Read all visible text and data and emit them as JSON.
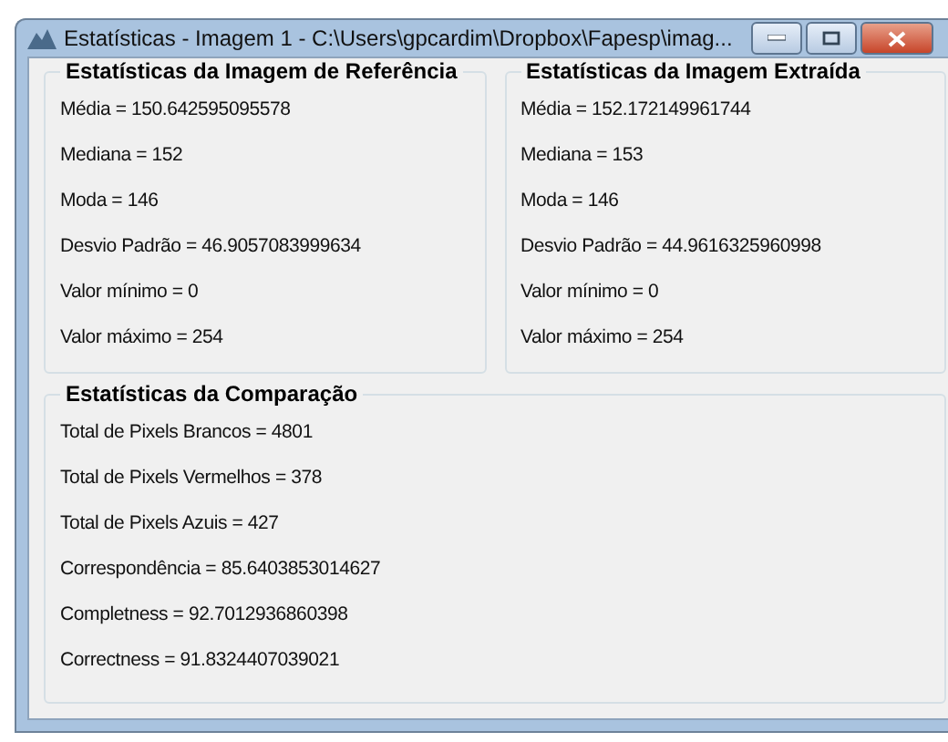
{
  "window": {
    "title": "Estatísticas - Imagem 1 - C:\\Users\\gpcardim\\Dropbox\\Fapesp\\imag..."
  },
  "groups": [
    {
      "title": "Estatísticas da Imagem de Referência",
      "lines": [
        "Média = 150.642595095578",
        "Mediana = 152",
        "Moda = 146",
        "Desvio Padrão = 46.9057083999634",
        "Valor mínimo = 0",
        "Valor máximo = 254"
      ]
    },
    {
      "title": "Estatísticas da Imagem Extraída",
      "lines": [
        "Média = 152.172149961744",
        "Mediana = 153",
        "Moda = 146",
        "Desvio Padrão = 44.9616325960998",
        "Valor mínimo = 0",
        "Valor máximo = 254"
      ]
    },
    {
      "title": "Estatísticas da Comparação",
      "lines": [
        "Total de Pixels Brancos = 4801",
        "Total de Pixels Vermelhos = 378",
        "Total de Pixels Azuis = 427",
        "Correspondência = 85.6403853014627",
        "Completness = 92.7012936860398",
        "Correctness = 91.8324407039021"
      ]
    }
  ]
}
